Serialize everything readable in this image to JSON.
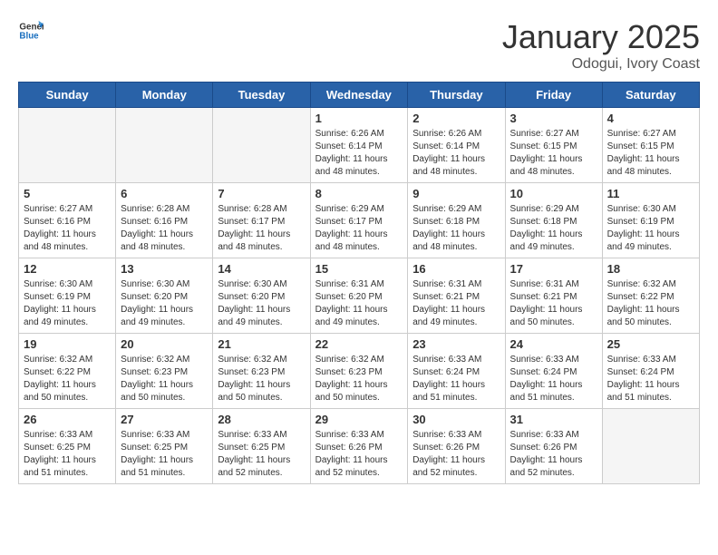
{
  "header": {
    "logo_general": "General",
    "logo_blue": "Blue",
    "month_title": "January 2025",
    "location": "Odogui, Ivory Coast"
  },
  "days_of_week": [
    "Sunday",
    "Monday",
    "Tuesday",
    "Wednesday",
    "Thursday",
    "Friday",
    "Saturday"
  ],
  "weeks": [
    [
      null,
      null,
      null,
      {
        "day": 1,
        "sunrise": "6:26 AM",
        "sunset": "6:14 PM",
        "daylight": "11 hours and 48 minutes."
      },
      {
        "day": 2,
        "sunrise": "6:26 AM",
        "sunset": "6:14 PM",
        "daylight": "11 hours and 48 minutes."
      },
      {
        "day": 3,
        "sunrise": "6:27 AM",
        "sunset": "6:15 PM",
        "daylight": "11 hours and 48 minutes."
      },
      {
        "day": 4,
        "sunrise": "6:27 AM",
        "sunset": "6:15 PM",
        "daylight": "11 hours and 48 minutes."
      }
    ],
    [
      {
        "day": 5,
        "sunrise": "6:27 AM",
        "sunset": "6:16 PM",
        "daylight": "11 hours and 48 minutes."
      },
      {
        "day": 6,
        "sunrise": "6:28 AM",
        "sunset": "6:16 PM",
        "daylight": "11 hours and 48 minutes."
      },
      {
        "day": 7,
        "sunrise": "6:28 AM",
        "sunset": "6:17 PM",
        "daylight": "11 hours and 48 minutes."
      },
      {
        "day": 8,
        "sunrise": "6:29 AM",
        "sunset": "6:17 PM",
        "daylight": "11 hours and 48 minutes."
      },
      {
        "day": 9,
        "sunrise": "6:29 AM",
        "sunset": "6:18 PM",
        "daylight": "11 hours and 48 minutes."
      },
      {
        "day": 10,
        "sunrise": "6:29 AM",
        "sunset": "6:18 PM",
        "daylight": "11 hours and 49 minutes."
      },
      {
        "day": 11,
        "sunrise": "6:30 AM",
        "sunset": "6:19 PM",
        "daylight": "11 hours and 49 minutes."
      }
    ],
    [
      {
        "day": 12,
        "sunrise": "6:30 AM",
        "sunset": "6:19 PM",
        "daylight": "11 hours and 49 minutes."
      },
      {
        "day": 13,
        "sunrise": "6:30 AM",
        "sunset": "6:20 PM",
        "daylight": "11 hours and 49 minutes."
      },
      {
        "day": 14,
        "sunrise": "6:30 AM",
        "sunset": "6:20 PM",
        "daylight": "11 hours and 49 minutes."
      },
      {
        "day": 15,
        "sunrise": "6:31 AM",
        "sunset": "6:20 PM",
        "daylight": "11 hours and 49 minutes."
      },
      {
        "day": 16,
        "sunrise": "6:31 AM",
        "sunset": "6:21 PM",
        "daylight": "11 hours and 49 minutes."
      },
      {
        "day": 17,
        "sunrise": "6:31 AM",
        "sunset": "6:21 PM",
        "daylight": "11 hours and 50 minutes."
      },
      {
        "day": 18,
        "sunrise": "6:32 AM",
        "sunset": "6:22 PM",
        "daylight": "11 hours and 50 minutes."
      }
    ],
    [
      {
        "day": 19,
        "sunrise": "6:32 AM",
        "sunset": "6:22 PM",
        "daylight": "11 hours and 50 minutes."
      },
      {
        "day": 20,
        "sunrise": "6:32 AM",
        "sunset": "6:23 PM",
        "daylight": "11 hours and 50 minutes."
      },
      {
        "day": 21,
        "sunrise": "6:32 AM",
        "sunset": "6:23 PM",
        "daylight": "11 hours and 50 minutes."
      },
      {
        "day": 22,
        "sunrise": "6:32 AM",
        "sunset": "6:23 PM",
        "daylight": "11 hours and 50 minutes."
      },
      {
        "day": 23,
        "sunrise": "6:33 AM",
        "sunset": "6:24 PM",
        "daylight": "11 hours and 51 minutes."
      },
      {
        "day": 24,
        "sunrise": "6:33 AM",
        "sunset": "6:24 PM",
        "daylight": "11 hours and 51 minutes."
      },
      {
        "day": 25,
        "sunrise": "6:33 AM",
        "sunset": "6:24 PM",
        "daylight": "11 hours and 51 minutes."
      }
    ],
    [
      {
        "day": 26,
        "sunrise": "6:33 AM",
        "sunset": "6:25 PM",
        "daylight": "11 hours and 51 minutes."
      },
      {
        "day": 27,
        "sunrise": "6:33 AM",
        "sunset": "6:25 PM",
        "daylight": "11 hours and 51 minutes."
      },
      {
        "day": 28,
        "sunrise": "6:33 AM",
        "sunset": "6:25 PM",
        "daylight": "11 hours and 52 minutes."
      },
      {
        "day": 29,
        "sunrise": "6:33 AM",
        "sunset": "6:26 PM",
        "daylight": "11 hours and 52 minutes."
      },
      {
        "day": 30,
        "sunrise": "6:33 AM",
        "sunset": "6:26 PM",
        "daylight": "11 hours and 52 minutes."
      },
      {
        "day": 31,
        "sunrise": "6:33 AM",
        "sunset": "6:26 PM",
        "daylight": "11 hours and 52 minutes."
      },
      null
    ]
  ],
  "labels": {
    "sunrise_prefix": "Sunrise: ",
    "sunset_prefix": "Sunset: ",
    "daylight_prefix": "Daylight: "
  }
}
